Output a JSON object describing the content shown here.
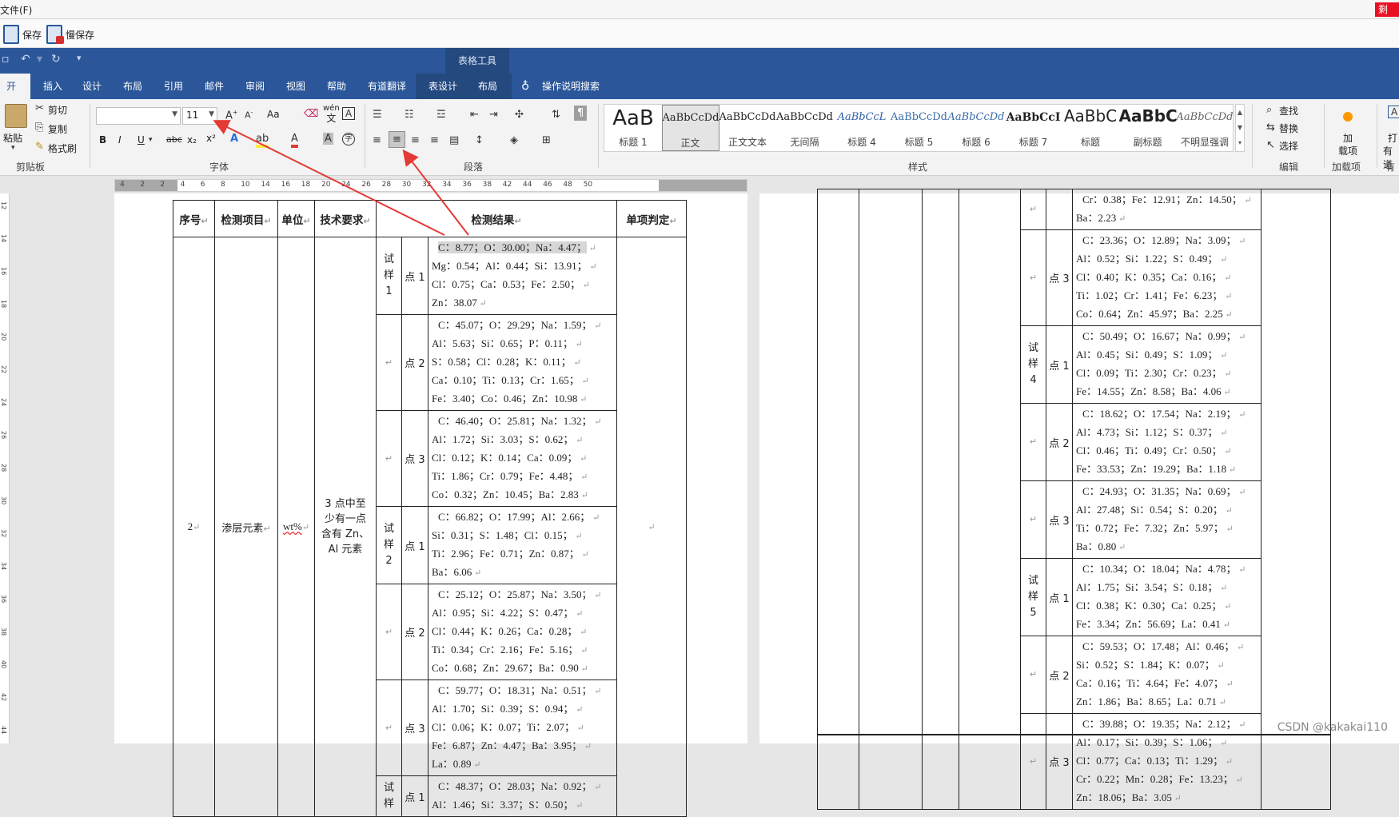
{
  "menubar": {
    "file": "文件(F)",
    "red_button": "剩"
  },
  "savebar": {
    "save": "保存",
    "slow_save": "慢保存"
  },
  "titlebar": {
    "context_label": "表格工具"
  },
  "tabs": [
    {
      "label": "开始"
    },
    {
      "label": "插入"
    },
    {
      "label": "设计"
    },
    {
      "label": "布局"
    },
    {
      "label": "引用"
    },
    {
      "label": "邮件"
    },
    {
      "label": "审阅"
    },
    {
      "label": "视图"
    },
    {
      "label": "帮助"
    },
    {
      "label": "有道翻译"
    },
    {
      "label": "表设计"
    },
    {
      "label": "布局"
    }
  ],
  "tell_me": "操作说明搜索",
  "clipboard": {
    "paste": "粘贴",
    "cut": "剪切",
    "copy": "复制",
    "format_painter": "格式刷",
    "label": "剪贴板"
  },
  "font": {
    "name": "",
    "size": "11",
    "label": "字体",
    "bold": "B",
    "italic": "I",
    "underline": "U",
    "strike": "abc",
    "sub": "x₂",
    "sup": "x²",
    "case": "Aa",
    "phonetic_top": "wén",
    "phonetic_bottom": "文"
  },
  "paragraph": {
    "label": "段落"
  },
  "styles": {
    "label": "样式",
    "items": [
      {
        "preview": "AaB",
        "name": "标题 1"
      },
      {
        "preview": "AaBbCcDd",
        "name": "正文"
      },
      {
        "preview": "AaBbCcDd",
        "name": "正文文本"
      },
      {
        "preview": "AaBbCcDd",
        "name": "无间隔"
      },
      {
        "preview": "AaBbCcL",
        "name": "标题 4"
      },
      {
        "preview": "AaBbCcDd",
        "name": "标题 5"
      },
      {
        "preview": "AaBbCcDd",
        "name": "标题 6"
      },
      {
        "preview": "AaBbCcI",
        "name": "标题 7"
      },
      {
        "preview": "AaBbC",
        "name": "标题"
      },
      {
        "preview": "AaBbC",
        "name": "副标题"
      },
      {
        "preview": "AaBbCcDd",
        "name": "不明显强调"
      }
    ]
  },
  "editing": {
    "find": "查找",
    "replace": "替换",
    "select": "选择",
    "label": "编辑"
  },
  "addin": {
    "load": "加载项",
    "label": "加载项",
    "load_line1": "加",
    "load_line2": "载项"
  },
  "youdao": {
    "label": "有道",
    "l1": "打",
    "l2": "有道"
  },
  "ruler_numbers": [
    "4",
    "2",
    "2",
    "4",
    "6",
    "8",
    "10",
    "14",
    "16",
    "18",
    "20",
    "24",
    "26",
    "28",
    "30",
    "32",
    "34",
    "36",
    "38",
    "42",
    "44",
    "46",
    "48",
    "50"
  ],
  "vruler_numbers": [
    "12",
    "14",
    "16",
    "18",
    "20",
    "22",
    "24",
    "26",
    "28",
    "30",
    "32",
    "34",
    "36",
    "38",
    "40",
    "42",
    "44"
  ],
  "table_left": {
    "headers": [
      "序号",
      "检测项目",
      "单位",
      "技术要求",
      "检测结果",
      "单项判定"
    ],
    "seq": "2",
    "item": "渗层元素",
    "unit": "wt%",
    "requirement": [
      "3 点中至",
      "少有一点",
      "含有 Zn、",
      "Al 元素"
    ],
    "rows": [
      {
        "sample": [
          "试",
          "样",
          "1"
        ],
        "point": "点 1",
        "lines": [
          "C：8.77；O：30.00；Na：4.47；",
          "Mg：0.54；Al：0.44；Si：13.91；",
          "Cl：0.75；Ca：0.53；Fe：2.50；",
          "Zn：38.07"
        ]
      },
      {
        "sample": [],
        "point": "点 2",
        "lines": [
          "C：45.07；O：29.29；Na：1.59；",
          "Al：5.63；Si：0.65；P：0.11；",
          "S：0.58；Cl：0.28；K：0.11；",
          "Ca：0.10；Ti：0.13；Cr：1.65；",
          "Fe：3.40；Co：0.46；Zn：10.98"
        ]
      },
      {
        "sample": [],
        "point": "点 3",
        "lines": [
          "C：46.40；O：25.81；Na：1.32；",
          "Al：1.72；Si：3.03；S：0.62；",
          "Cl：0.12；K：0.14；Ca：0.09；",
          "Ti：1.86；Cr：0.79；Fe：4.48；",
          "Co：0.32；Zn：10.45；Ba：2.83"
        ]
      },
      {
        "sample": [
          "试",
          "样",
          "2"
        ],
        "point": "点 1",
        "lines": [
          "C：66.82；O：17.99；Al：2.66；",
          "Si：0.31；S：1.48；Cl：0.15；",
          "Ti：2.96；Fe：0.71；Zn：0.87；",
          "Ba：6.06"
        ]
      },
      {
        "sample": [],
        "point": "点 2",
        "lines": [
          "C：25.12；O：25.87；Na：3.50；",
          "Al：0.95；Si：4.22；S：0.47；",
          "Cl：0.44；K：0.26；Ca：0.28；",
          "Ti：0.34；Cr：2.16；Fe：5.16；",
          "Co：0.68；Zn：29.67；Ba：0.90"
        ]
      },
      {
        "sample": [],
        "point": "点 3",
        "lines": [
          "C：59.77；O：18.31；Na：0.51；",
          "Al：1.70；Si：0.39；S：0.94；",
          "Cl：0.06；K：0.07；Ti：2.07；",
          "Fe：6.87；Zn：4.47；Ba：3.95；",
          "La：0.89"
        ]
      },
      {
        "sample": [
          "试",
          "样"
        ],
        "point": "点 1",
        "lines": [
          "C：48.37；O：28.03；Na：0.92；",
          "Al：1.46；Si：3.37；S：0.50；"
        ]
      }
    ]
  },
  "table_right": {
    "rows": [
      {
        "sample": [],
        "point": "",
        "lines": [
          "Cr：0.38；Fe：12.91；Zn：14.50；",
          "Ba：2.23"
        ]
      },
      {
        "sample": [],
        "point": "点 3",
        "lines": [
          "C：23.36；O：12.89；Na：3.09；",
          "Al：0.52；Si：1.22；S：0.49；",
          "Cl：0.40；K：0.35；Ca：0.16；",
          "Ti：1.02；Cr：1.41；Fe：6.23；",
          "Co：0.64；Zn：45.97；Ba：2.25"
        ]
      },
      {
        "sample": [
          "试",
          "样",
          "4"
        ],
        "point": "点 1",
        "lines": [
          "C：50.49；O：16.67；Na：0.99；",
          "Al：0.45；Si：0.49；S：1.09；",
          "Cl：0.09；Ti：2.30；Cr：0.23；",
          "Fe：14.55；Zn：8.58；Ba：4.06"
        ]
      },
      {
        "sample": [],
        "point": "点 2",
        "lines": [
          "C：18.62；O：17.54；Na：2.19；",
          "Al：4.73；Si：1.12；S：0.37；",
          "Cl：0.46；Ti：0.49；Cr：0.50；",
          "Fe：33.53；Zn：19.29；Ba：1.18"
        ]
      },
      {
        "sample": [],
        "point": "点 3",
        "lines": [
          "C：24.93；O：31.35；Na：0.69；",
          "Al：27.48；Si：0.54；S：0.20；",
          "Ti：0.72；Fe：7.32；Zn：5.97；",
          "Ba：0.80"
        ]
      },
      {
        "sample": [
          "试",
          "样",
          "5"
        ],
        "point": "点 1",
        "lines": [
          "C：10.34；O：18.04；Na：4.78；",
          "Al：1.75；Si：3.54；S：0.18；",
          "Cl：0.38；K：0.30；Ca：0.25；",
          "Fe：3.34；Zn：56.69；La：0.41"
        ]
      },
      {
        "sample": [],
        "point": "点 2",
        "lines": [
          "C：59.53；O：17.48；Al：0.46；",
          "Si：0.52；S：1.84；K：0.07；",
          "Ca：0.16；Ti：4.64；Fe：4.07；",
          "Zn：1.86；Ba：8.65；La：0.71"
        ]
      },
      {
        "sample": [],
        "point": "点 3",
        "lines": [
          "C：39.88；O：19.35；Na：2.12；",
          "Al：0.17；Si：0.39；S：1.06；",
          "Cl：0.77；Ca：0.13；Ti：1.29；",
          "Cr：0.22；Mn：0.28；Fe：13.23；",
          "Zn：18.06；Ba：3.05"
        ]
      }
    ]
  },
  "watermark": "CSDN @kakakai110",
  "colors": {
    "ribbon_blue": "#2b579a",
    "annotation_red": "#e53935"
  }
}
